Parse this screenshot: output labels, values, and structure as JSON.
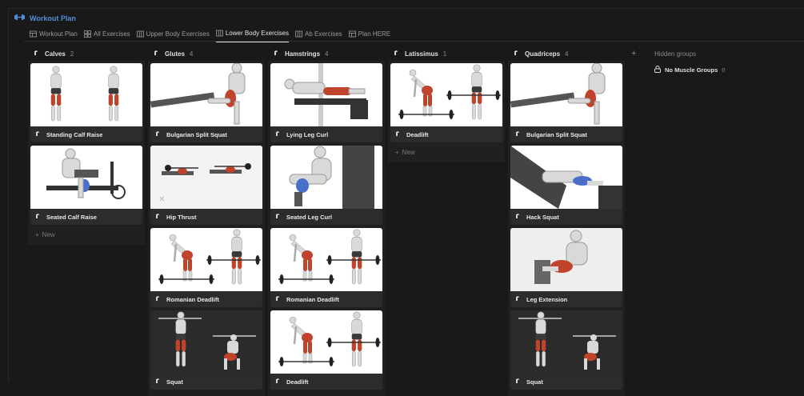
{
  "app": {
    "title": "Workout Plan"
  },
  "tabs": [
    {
      "label": "Workout Plan",
      "icon": "table-icon"
    },
    {
      "label": "All Exercises",
      "icon": "gallery-icon"
    },
    {
      "label": "Upper Body Exercises",
      "icon": "board-icon"
    },
    {
      "label": "Lower Body Exercises",
      "icon": "board-icon",
      "active": true
    },
    {
      "label": "Ab Exercises",
      "icon": "board-icon"
    },
    {
      "label": "Plan HERE",
      "icon": "table-icon"
    }
  ],
  "columns": [
    {
      "name": "Calves",
      "count": "2",
      "cards": [
        {
          "title": "Standing Calf Raise",
          "img": "standing-calf-raise"
        },
        {
          "title": "Seated Calf Raise",
          "img": "seated-calf-raise"
        }
      ],
      "new": "New"
    },
    {
      "name": "Glutes",
      "count": "4",
      "cards": [
        {
          "title": "Bulgarian Split Squat",
          "img": "bulgarian-split-squat"
        },
        {
          "title": "Hip Thrust",
          "img": "hip-thrust"
        },
        {
          "title": "Romanian Deadlift",
          "img": "romanian-deadlift"
        },
        {
          "title": "Squat",
          "img": "squat"
        }
      ]
    },
    {
      "name": "Hamstrings",
      "count": "4",
      "cards": [
        {
          "title": "Lying Leg Curl",
          "img": "lying-leg-curl"
        },
        {
          "title": "Seated Leg Curl",
          "img": "seated-leg-curl"
        },
        {
          "title": "Romanian Deadlift",
          "img": "romanian-deadlift"
        },
        {
          "title": "Deadlift",
          "img": "deadlift"
        }
      ]
    },
    {
      "name": "Latissimus",
      "count": "1",
      "cards": [
        {
          "title": "Deadlift",
          "img": "deadlift"
        }
      ],
      "new": "New"
    },
    {
      "name": "Quadriceps",
      "count": "4",
      "cards": [
        {
          "title": "Bulgarian Split Squat",
          "img": "bulgarian-split-squat"
        },
        {
          "title": "Hack Squat",
          "img": "hack-squat"
        },
        {
          "title": "Leg Extension",
          "img": "leg-extension"
        },
        {
          "title": "Squat",
          "img": "squat"
        }
      ]
    }
  ],
  "hidden_groups": {
    "label": "Hidden groups",
    "groups": [
      {
        "name": "No Muscle Groups",
        "count": "0"
      }
    ]
  },
  "colors": {
    "accent": "#4f8fd6",
    "muscle": "#c0442c",
    "background": "#191919"
  }
}
